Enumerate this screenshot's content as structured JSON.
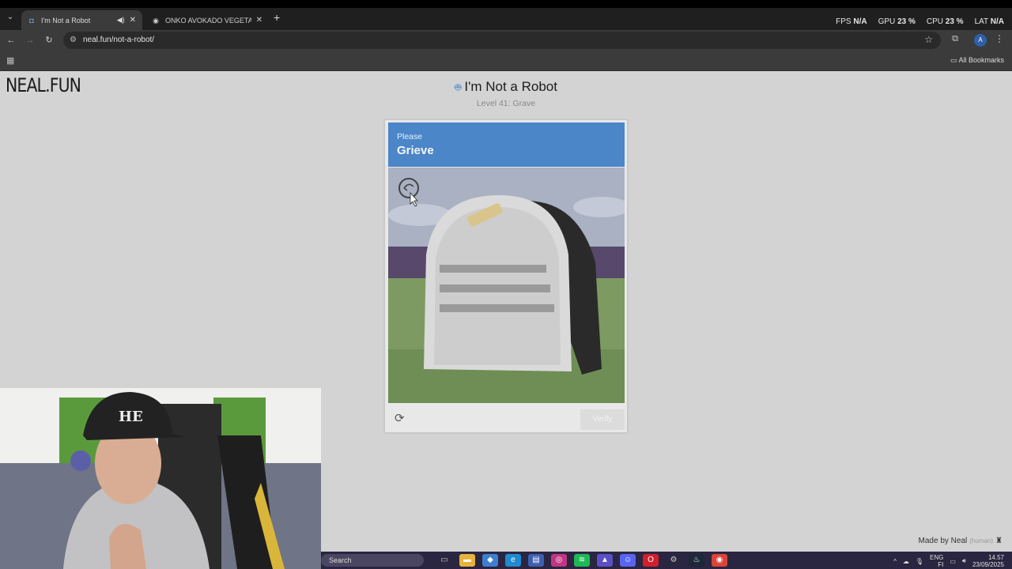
{
  "browser": {
    "tabs": [
      {
        "title": "I'm Not a Robot",
        "active": true
      },
      {
        "title": "ONKO AVOKADO VEGETABLE -",
        "active": false
      }
    ],
    "url": "neal.fun/not-a-robot/",
    "bookmarks_label": "All Bookmarks",
    "profile_initial": "A"
  },
  "perf_overlay": {
    "fps_label": "FPS",
    "fps_value": "N/A",
    "gpu_label": "GPU",
    "gpu_value": "23 %",
    "cpu_label": "CPU",
    "cpu_value": "23 %",
    "lat_label": "LAT",
    "lat_value": "N/A"
  },
  "page": {
    "logo": "NEAL.FUN",
    "title": "I'm Not a Robot",
    "subtitle": "Level 41: Grave",
    "captcha": {
      "prompt": "Please",
      "word": "Grieve",
      "verify_label": "Verify"
    },
    "made_by": "Made by Neal",
    "human_badge": "(human)"
  },
  "taskbar": {
    "search_placeholder": "Search",
    "lang": "ENG",
    "lang2": "FI",
    "time": "14.57",
    "date": "23/09/2025"
  },
  "colors": {
    "captcha_header": "#4a86c8",
    "page_bg": "#d3d3d3"
  }
}
